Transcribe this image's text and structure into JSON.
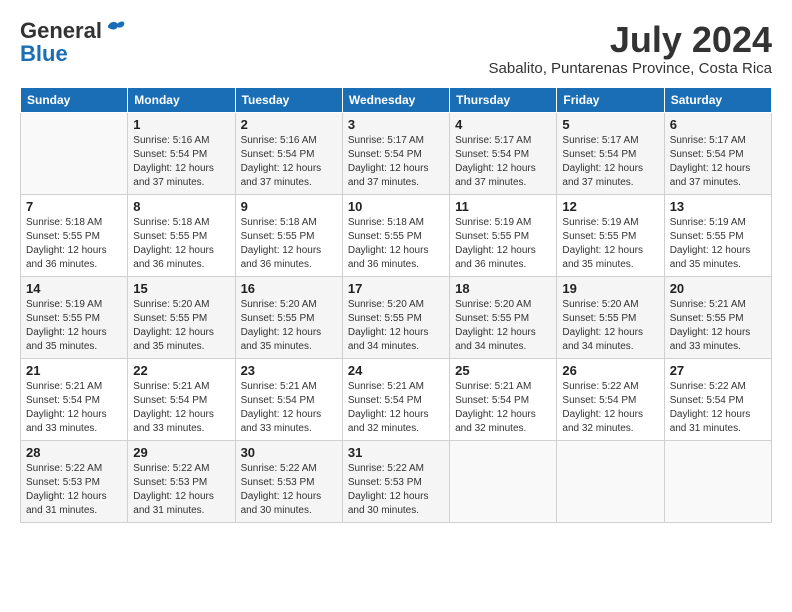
{
  "header": {
    "logo_general": "General",
    "logo_blue": "Blue",
    "month_title": "July 2024",
    "subtitle": "Sabalito, Puntarenas Province, Costa Rica"
  },
  "days_of_week": [
    "Sunday",
    "Monday",
    "Tuesday",
    "Wednesday",
    "Thursday",
    "Friday",
    "Saturday"
  ],
  "weeks": [
    [
      {
        "day": "",
        "detail": ""
      },
      {
        "day": "1",
        "detail": "Sunrise: 5:16 AM\nSunset: 5:54 PM\nDaylight: 12 hours\nand 37 minutes."
      },
      {
        "day": "2",
        "detail": "Sunrise: 5:16 AM\nSunset: 5:54 PM\nDaylight: 12 hours\nand 37 minutes."
      },
      {
        "day": "3",
        "detail": "Sunrise: 5:17 AM\nSunset: 5:54 PM\nDaylight: 12 hours\nand 37 minutes."
      },
      {
        "day": "4",
        "detail": "Sunrise: 5:17 AM\nSunset: 5:54 PM\nDaylight: 12 hours\nand 37 minutes."
      },
      {
        "day": "5",
        "detail": "Sunrise: 5:17 AM\nSunset: 5:54 PM\nDaylight: 12 hours\nand 37 minutes."
      },
      {
        "day": "6",
        "detail": "Sunrise: 5:17 AM\nSunset: 5:54 PM\nDaylight: 12 hours\nand 37 minutes."
      }
    ],
    [
      {
        "day": "7",
        "detail": "Sunrise: 5:18 AM\nSunset: 5:55 PM\nDaylight: 12 hours\nand 36 minutes."
      },
      {
        "day": "8",
        "detail": "Sunrise: 5:18 AM\nSunset: 5:55 PM\nDaylight: 12 hours\nand 36 minutes."
      },
      {
        "day": "9",
        "detail": "Sunrise: 5:18 AM\nSunset: 5:55 PM\nDaylight: 12 hours\nand 36 minutes."
      },
      {
        "day": "10",
        "detail": "Sunrise: 5:18 AM\nSunset: 5:55 PM\nDaylight: 12 hours\nand 36 minutes."
      },
      {
        "day": "11",
        "detail": "Sunrise: 5:19 AM\nSunset: 5:55 PM\nDaylight: 12 hours\nand 36 minutes."
      },
      {
        "day": "12",
        "detail": "Sunrise: 5:19 AM\nSunset: 5:55 PM\nDaylight: 12 hours\nand 35 minutes."
      },
      {
        "day": "13",
        "detail": "Sunrise: 5:19 AM\nSunset: 5:55 PM\nDaylight: 12 hours\nand 35 minutes."
      }
    ],
    [
      {
        "day": "14",
        "detail": "Sunrise: 5:19 AM\nSunset: 5:55 PM\nDaylight: 12 hours\nand 35 minutes."
      },
      {
        "day": "15",
        "detail": "Sunrise: 5:20 AM\nSunset: 5:55 PM\nDaylight: 12 hours\nand 35 minutes."
      },
      {
        "day": "16",
        "detail": "Sunrise: 5:20 AM\nSunset: 5:55 PM\nDaylight: 12 hours\nand 35 minutes."
      },
      {
        "day": "17",
        "detail": "Sunrise: 5:20 AM\nSunset: 5:55 PM\nDaylight: 12 hours\nand 34 minutes."
      },
      {
        "day": "18",
        "detail": "Sunrise: 5:20 AM\nSunset: 5:55 PM\nDaylight: 12 hours\nand 34 minutes."
      },
      {
        "day": "19",
        "detail": "Sunrise: 5:20 AM\nSunset: 5:55 PM\nDaylight: 12 hours\nand 34 minutes."
      },
      {
        "day": "20",
        "detail": "Sunrise: 5:21 AM\nSunset: 5:55 PM\nDaylight: 12 hours\nand 33 minutes."
      }
    ],
    [
      {
        "day": "21",
        "detail": "Sunrise: 5:21 AM\nSunset: 5:54 PM\nDaylight: 12 hours\nand 33 minutes."
      },
      {
        "day": "22",
        "detail": "Sunrise: 5:21 AM\nSunset: 5:54 PM\nDaylight: 12 hours\nand 33 minutes."
      },
      {
        "day": "23",
        "detail": "Sunrise: 5:21 AM\nSunset: 5:54 PM\nDaylight: 12 hours\nand 33 minutes."
      },
      {
        "day": "24",
        "detail": "Sunrise: 5:21 AM\nSunset: 5:54 PM\nDaylight: 12 hours\nand 32 minutes."
      },
      {
        "day": "25",
        "detail": "Sunrise: 5:21 AM\nSunset: 5:54 PM\nDaylight: 12 hours\nand 32 minutes."
      },
      {
        "day": "26",
        "detail": "Sunrise: 5:22 AM\nSunset: 5:54 PM\nDaylight: 12 hours\nand 32 minutes."
      },
      {
        "day": "27",
        "detail": "Sunrise: 5:22 AM\nSunset: 5:54 PM\nDaylight: 12 hours\nand 31 minutes."
      }
    ],
    [
      {
        "day": "28",
        "detail": "Sunrise: 5:22 AM\nSunset: 5:53 PM\nDaylight: 12 hours\nand 31 minutes."
      },
      {
        "day": "29",
        "detail": "Sunrise: 5:22 AM\nSunset: 5:53 PM\nDaylight: 12 hours\nand 31 minutes."
      },
      {
        "day": "30",
        "detail": "Sunrise: 5:22 AM\nSunset: 5:53 PM\nDaylight: 12 hours\nand 30 minutes."
      },
      {
        "day": "31",
        "detail": "Sunrise: 5:22 AM\nSunset: 5:53 PM\nDaylight: 12 hours\nand 30 minutes."
      },
      {
        "day": "",
        "detail": ""
      },
      {
        "day": "",
        "detail": ""
      },
      {
        "day": "",
        "detail": ""
      }
    ]
  ]
}
